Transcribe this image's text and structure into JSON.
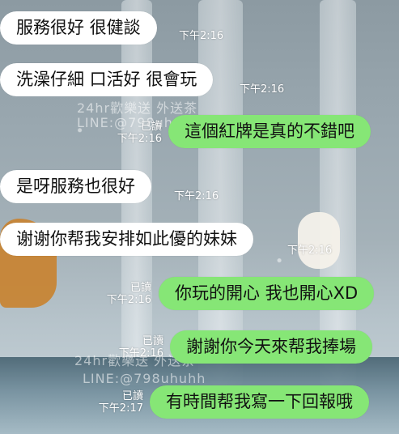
{
  "messages": [
    {
      "dir": "in",
      "text": "服務很好 很健談",
      "time": "下午2:16"
    },
    {
      "dir": "in",
      "text": "洗澡仔細 口活好 很會玩",
      "time": "下午2:16"
    },
    {
      "dir": "out",
      "text": "這個紅牌是真的不錯吧",
      "time": "下午2:16",
      "read": "已讀"
    },
    {
      "dir": "in",
      "text": "是呀服務也很好",
      "time": "下午2:16"
    },
    {
      "dir": "in",
      "text": "谢谢你帮我安排如此優的妹妹",
      "time": "下午2:16"
    },
    {
      "dir": "out",
      "text": "你玩的開心 我也開心XD",
      "time": "下午2:16",
      "read": "已讀"
    },
    {
      "dir": "out",
      "text": "謝謝你今天來帮我捧場",
      "time": "下午2:16",
      "read": "已讀"
    },
    {
      "dir": "out",
      "text": "有時間帮我寫一下回報哦",
      "time": "下午2:17",
      "read": "已讀"
    }
  ],
  "watermarks": [
    "24hr歡樂送 外送茶",
    "LINE:@798uhuhh",
    "24hr歡樂送 外送茶",
    "LINE:@798uhuhh"
  ],
  "colors": {
    "incoming_bubble": "#ffffff",
    "outgoing_bubble": "#86e676",
    "meta_text": "#ffffff"
  }
}
